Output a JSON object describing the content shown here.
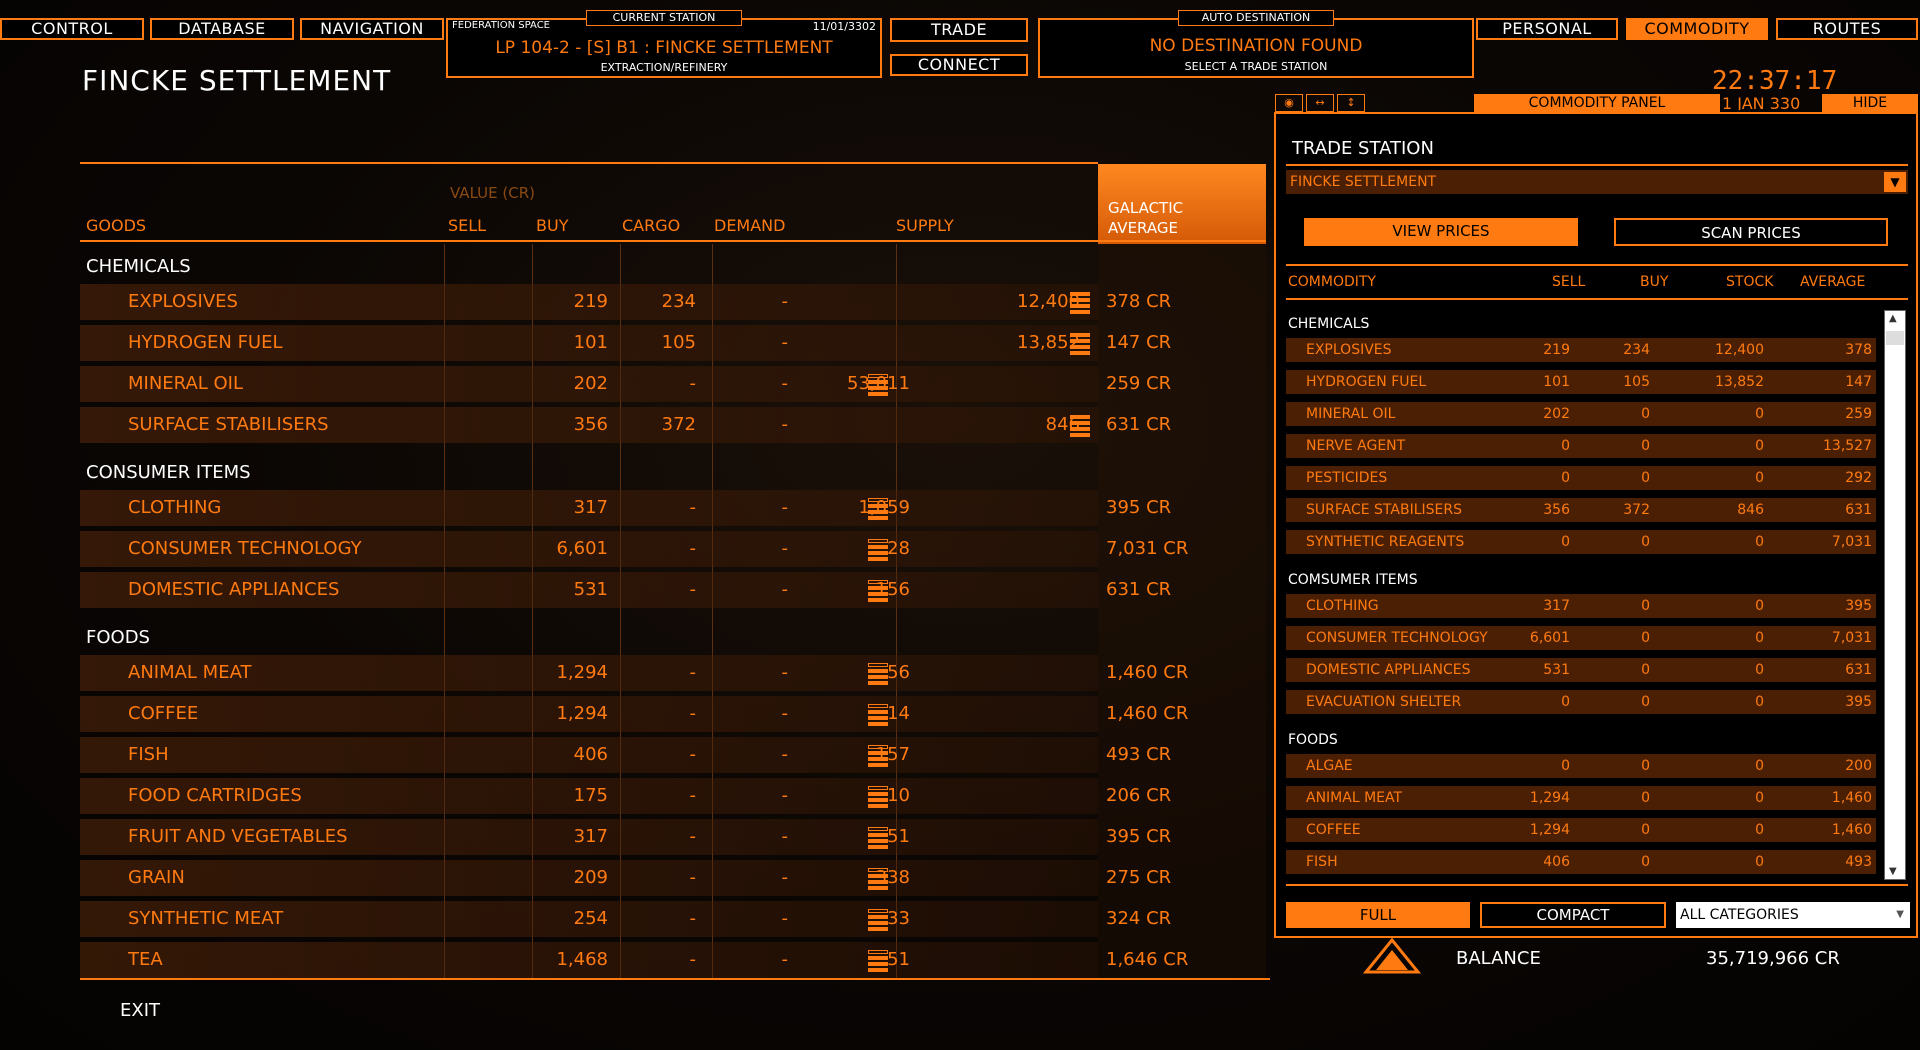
{
  "topbar": {
    "control": "CONTROL",
    "database": "DATABASE",
    "navigation": "NAVIGATION",
    "trade": "TRADE",
    "connect": "CONNECT",
    "personal": "PERSONAL",
    "commodity": "COMMODITY",
    "routes": "ROUTES"
  },
  "current_station": {
    "tab": "CURRENT STATION",
    "space": "FEDERATION SPACE",
    "date": "11/01/3302",
    "name": "LP 104-2 - [S] B1 : FINCKE SETTLEMENT",
    "type": "EXTRACTION/REFINERY"
  },
  "auto_destination": {
    "tab": "AUTO DESTINATION",
    "title": "NO DESTINATION FOUND",
    "subtitle": "SELECT A TRADE STATION"
  },
  "page_title": "FINCKE SETTLEMENT",
  "clock": {
    "time": "22:37:17",
    "date": "1 JAN 330"
  },
  "table": {
    "headers": {
      "goods": "GOODS",
      "value": "VALUE (CR)",
      "sell": "SELL",
      "buy": "BUY",
      "cargo": "CARGO",
      "demand": "DEMAND",
      "supply": "SUPPLY",
      "galactic_1": "GALACTIC",
      "galactic_2": "AVERAGE"
    },
    "categories": {
      "chemicals": "CHEMICALS",
      "consumer": "CONSUMER ITEMS",
      "foods": "FOODS"
    },
    "rows": [
      {
        "name": "EXPLOSIVES",
        "sell": "219",
        "buy": "234",
        "cargo": "-",
        "demand": "",
        "supply": "12,400",
        "gal": "378 CR"
      },
      {
        "name": "HYDROGEN FUEL",
        "sell": "101",
        "buy": "105",
        "cargo": "-",
        "demand": "",
        "supply": "13,852",
        "gal": "147 CR"
      },
      {
        "name": "MINERAL OIL",
        "sell": "202",
        "buy": "-",
        "cargo": "-",
        "demand": "53,011",
        "supply": "",
        "gal": "259 CR"
      },
      {
        "name": "SURFACE STABILISERS",
        "sell": "356",
        "buy": "372",
        "cargo": "-",
        "demand": "",
        "supply": "846",
        "gal": "631 CR"
      },
      {
        "name": "CLOTHING",
        "sell": "317",
        "buy": "-",
        "cargo": "-",
        "demand": "1,059",
        "supply": "",
        "gal": "395 CR"
      },
      {
        "name": "CONSUMER TECHNOLOGY",
        "sell": "6,601",
        "buy": "-",
        "cargo": "-",
        "demand": "28",
        "supply": "",
        "gal": "7,031 CR"
      },
      {
        "name": "DOMESTIC APPLIANCES",
        "sell": "531",
        "buy": "-",
        "cargo": "-",
        "demand": "156",
        "supply": "",
        "gal": "631 CR"
      },
      {
        "name": "ANIMAL MEAT",
        "sell": "1,294",
        "buy": "-",
        "cargo": "-",
        "demand": "56",
        "supply": "",
        "gal": "1,460 CR"
      },
      {
        "name": "COFFEE",
        "sell": "1,294",
        "buy": "-",
        "cargo": "-",
        "demand": "14",
        "supply": "",
        "gal": "1,460 CR"
      },
      {
        "name": "FISH",
        "sell": "406",
        "buy": "-",
        "cargo": "-",
        "demand": "157",
        "supply": "",
        "gal": "493 CR"
      },
      {
        "name": "FOOD CARTRIDGES",
        "sell": "175",
        "buy": "-",
        "cargo": "-",
        "demand": "10",
        "supply": "",
        "gal": "206 CR"
      },
      {
        "name": "FRUIT AND VEGETABLES",
        "sell": "317",
        "buy": "-",
        "cargo": "-",
        "demand": "51",
        "supply": "",
        "gal": "395 CR"
      },
      {
        "name": "GRAIN",
        "sell": "209",
        "buy": "-",
        "cargo": "-",
        "demand": "338",
        "supply": "",
        "gal": "275 CR"
      },
      {
        "name": "SYNTHETIC MEAT",
        "sell": "254",
        "buy": "-",
        "cargo": "-",
        "demand": "33",
        "supply": "",
        "gal": "324 CR"
      },
      {
        "name": "TEA",
        "sell": "1,468",
        "buy": "-",
        "cargo": "-",
        "demand": "51",
        "supply": "",
        "gal": "1,646 CR"
      }
    ]
  },
  "exit": "EXIT",
  "panel": {
    "title_bar": "COMMODITY PANEL",
    "hide": "HIDE",
    "heading": "TRADE STATION",
    "station": "FINCKE SETTLEMENT",
    "view_prices": "VIEW PRICES",
    "scan_prices": "SCAN PRICES",
    "headers": {
      "commodity": "COMMODITY",
      "sell": "SELL",
      "buy": "BUY",
      "stock": "STOCK",
      "average": "AVERAGE"
    },
    "cats": {
      "chemicals": "CHEMICALS",
      "consumer": "COMSUMER ITEMS",
      "foods": "FOODS"
    },
    "rows": [
      {
        "name": "EXPLOSIVES",
        "sell": "219",
        "buy": "234",
        "stock": "12,400",
        "avg": "378"
      },
      {
        "name": "HYDROGEN FUEL",
        "sell": "101",
        "buy": "105",
        "stock": "13,852",
        "avg": "147"
      },
      {
        "name": "MINERAL OIL",
        "sell": "202",
        "buy": "0",
        "stock": "0",
        "avg": "259"
      },
      {
        "name": "NERVE AGENT",
        "sell": "0",
        "buy": "0",
        "stock": "0",
        "avg": "13,527"
      },
      {
        "name": "PESTICIDES",
        "sell": "0",
        "buy": "0",
        "stock": "0",
        "avg": "292"
      },
      {
        "name": "SURFACE STABILISERS",
        "sell": "356",
        "buy": "372",
        "stock": "846",
        "avg": "631"
      },
      {
        "name": "SYNTHETIC REAGENTS",
        "sell": "0",
        "buy": "0",
        "stock": "0",
        "avg": "7,031"
      },
      {
        "name": "CLOTHING",
        "sell": "317",
        "buy": "0",
        "stock": "0",
        "avg": "395"
      },
      {
        "name": "CONSUMER TECHNOLOGY",
        "sell": "6,601",
        "buy": "0",
        "stock": "0",
        "avg": "7,031"
      },
      {
        "name": "DOMESTIC APPLIANCES",
        "sell": "531",
        "buy": "0",
        "stock": "0",
        "avg": "631"
      },
      {
        "name": "EVACUATION SHELTER",
        "sell": "0",
        "buy": "0",
        "stock": "0",
        "avg": "395"
      },
      {
        "name": "ALGAE",
        "sell": "0",
        "buy": "0",
        "stock": "0",
        "avg": "200"
      },
      {
        "name": "ANIMAL MEAT",
        "sell": "1,294",
        "buy": "0",
        "stock": "0",
        "avg": "1,460"
      },
      {
        "name": "COFFEE",
        "sell": "1,294",
        "buy": "0",
        "stock": "0",
        "avg": "1,460"
      },
      {
        "name": "FISH",
        "sell": "406",
        "buy": "0",
        "stock": "0",
        "avg": "493"
      }
    ],
    "full": "FULL",
    "compact": "COMPACT",
    "all_categories": "ALL CATEGORIES"
  },
  "balance": {
    "label": "BALANCE",
    "value": "35,719,966 CR"
  },
  "colors": {
    "accent": "#ff7a10",
    "row_bg": "#4a1f04"
  }
}
